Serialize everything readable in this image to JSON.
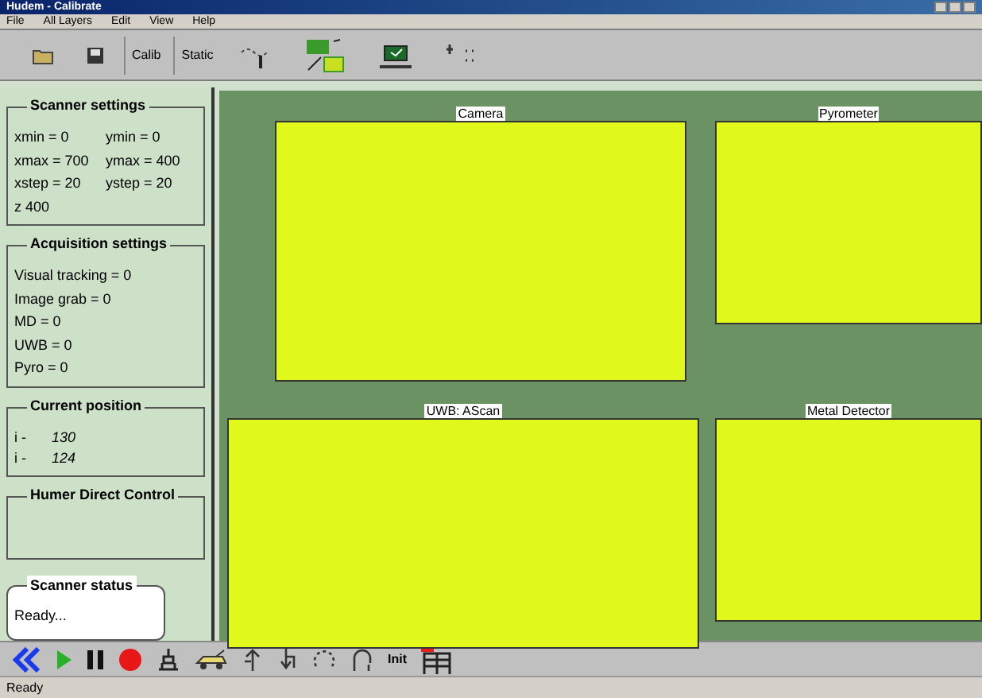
{
  "window": {
    "title": "Hudem - Calibrate"
  },
  "menu": [
    "File",
    "All Layers",
    "Edit",
    "View",
    "Help"
  ],
  "toolbar": [
    {
      "kind": "icon"
    },
    {
      "kind": "icon"
    },
    {
      "kind": "text",
      "label": "Calib"
    },
    {
      "kind": "text",
      "label": "Static"
    },
    {
      "kind": "icon"
    },
    {
      "kind": "icon"
    },
    {
      "kind": "icon"
    },
    {
      "kind": "icon"
    }
  ],
  "scanner_settings": {
    "title": "Scanner settings",
    "rows": [
      [
        "xmin = 0",
        "ymin = 0"
      ],
      [
        "xmax = 700",
        "ymax = 400"
      ],
      [
        "xstep = 20",
        "ystep = 20"
      ],
      [
        "z   400"
      ]
    ]
  },
  "acquisition_settings": {
    "title": "Acquisition settings",
    "rows": [
      "Visual tracking = 0",
      "Image grab = 0",
      "MD  = 0",
      "UWB = 0",
      "Pyro = 0"
    ]
  },
  "current_position": {
    "title": "Current position",
    "rows": [
      {
        "label": "i -",
        "value": "130"
      },
      {
        "label": "i -",
        "value": "124"
      }
    ]
  },
  "direct_control": {
    "title": "Humer Direct Control"
  },
  "scanner_status": {
    "title": "Scanner status",
    "text": "Ready..."
  },
  "views": [
    {
      "title": "Camera"
    },
    {
      "title": "Pyrometer"
    },
    {
      "title": "UWB: AScan"
    },
    {
      "title": "Metal Detector"
    }
  ],
  "controls": [
    {
      "kind": "icon"
    },
    {
      "kind": "icon"
    },
    {
      "kind": "icon"
    },
    {
      "kind": "icon"
    },
    {
      "kind": "icon"
    },
    {
      "kind": "icon"
    },
    {
      "kind": "icon"
    },
    {
      "kind": "icon"
    },
    {
      "kind": "icon"
    },
    {
      "kind": "icon"
    },
    {
      "kind": "text",
      "label": "Init"
    },
    {
      "kind": "icon"
    }
  ],
  "status_bar": {
    "text": "Ready"
  }
}
